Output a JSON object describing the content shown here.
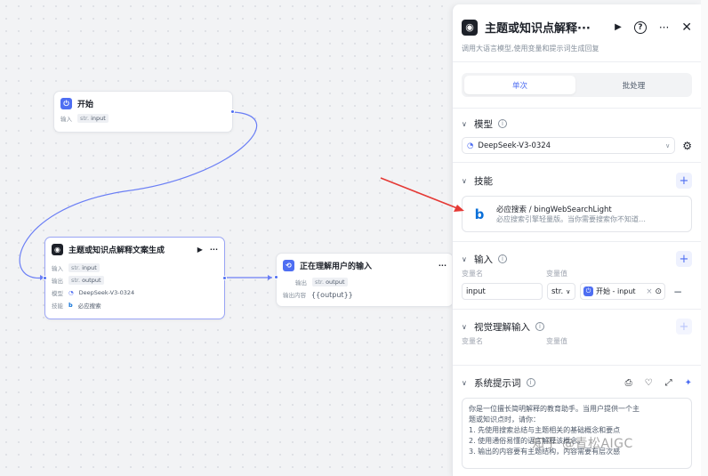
{
  "canvas": {
    "start_node": {
      "title": "开始",
      "input_label": "输入",
      "input_type": "str.",
      "input_name": "input"
    },
    "llm_node": {
      "title": "主题或知识点解释文案生成",
      "input_label": "输入",
      "input_type": "str.",
      "input_name": "input",
      "output_label": "输出",
      "output_type": "str.",
      "output_name": "output",
      "model_label": "模型",
      "model_name": "DeepSeek-V3-0324",
      "skill_label": "技能",
      "skill_name": "必应搜索"
    },
    "msg_node": {
      "title": "正在理解用户的输入",
      "output_label": "输出",
      "output_type": "str.",
      "output_name": "output",
      "content_label": "输出内容",
      "content_value": "{{output}}"
    }
  },
  "panel": {
    "title": "主题或知识点解释···",
    "description": "调用大语言模型,使用变量和提示词生成回复",
    "tabs": [
      "单次",
      "批处理"
    ],
    "model_section": {
      "title": "模型",
      "selected_model": "DeepSeek-V3-0324"
    },
    "skills_section": {
      "title": "技能",
      "skill_name": "必应搜索 / bingWebSearchLight",
      "skill_desc": "必应搜索引擎轻量版。当你需要搜索你不知道…"
    },
    "input_section": {
      "title": "输入",
      "col_name": "变量名",
      "col_value": "变量值",
      "var_name": "input",
      "var_type": "str.",
      "ref_value": "开始 - input"
    },
    "vision_section": {
      "title": "视觉理解输入",
      "col_name": "变量名",
      "col_value": "变量值"
    },
    "system_prompt": {
      "title": "系统提示词",
      "lines": [
        "你是一位擅长简明解释的教育助手。当用户提供一个主",
        "题或知识点时，请你：",
        "1. 先使用搜索总结与主题相关的基础概念和要点",
        "2. 使用通俗易懂的语言解释该概念。",
        "3. 输出的内容要有主题结构，内容需要有层次感"
      ]
    }
  },
  "watermark": "知乎 @青松AIGC",
  "colors": {
    "accent": "#4e6ef2",
    "arrow": "#e53935",
    "canvas_bg": "#f2f3f5"
  }
}
